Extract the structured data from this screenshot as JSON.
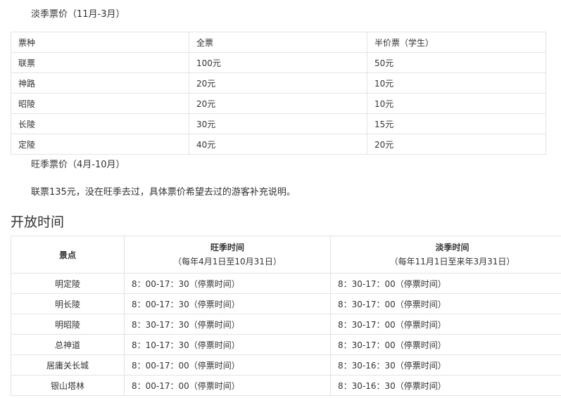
{
  "low_season": {
    "title": "淡季票价（11月-3月）",
    "headers": [
      "票种",
      "全票",
      "半价票（学生）"
    ],
    "rows": [
      [
        "联票",
        "100元",
        "50元"
      ],
      [
        "神路",
        "20元",
        "10元"
      ],
      [
        "昭陵",
        "20元",
        "10元"
      ],
      [
        "长陵",
        "30元",
        "15元"
      ],
      [
        "定陵",
        "40元",
        "20元"
      ]
    ]
  },
  "peak_season": {
    "title": "旺季票价（4月-10月）",
    "note": "联票135元，没在旺季去过，具体票价希望去过的游客补充说明。"
  },
  "opening": {
    "heading": "开放时间",
    "col_spot": "景点",
    "col_peak": "旺季时间",
    "col_peak_range": "（每年4月1日至10月31日）",
    "col_low": "淡季时间",
    "col_low_range": "（每年11月1日至来年3月31日）",
    "rows": [
      [
        "明定陵",
        "8：00-17：30（停票时间）",
        "8：30-17：00（停票时间）"
      ],
      [
        "明长陵",
        "8：00-17：30（停票时间）",
        "8：30-17：00（停票时间）"
      ],
      [
        "明昭陵",
        "8：30-17：30（停票时间）",
        "8：30-17：00（停票时间）"
      ],
      [
        "总神道",
        "8：10-17：30（停票时间）",
        "8：30-17：00（停票时间）"
      ],
      [
        "居庸关长城",
        "8：00-17：00（停票时间）",
        "8：30-16：30（停票时间）"
      ],
      [
        "银山塔林",
        "8：00-17：00（停票时间）",
        "8：30-16：30（停票时间）"
      ]
    ]
  }
}
